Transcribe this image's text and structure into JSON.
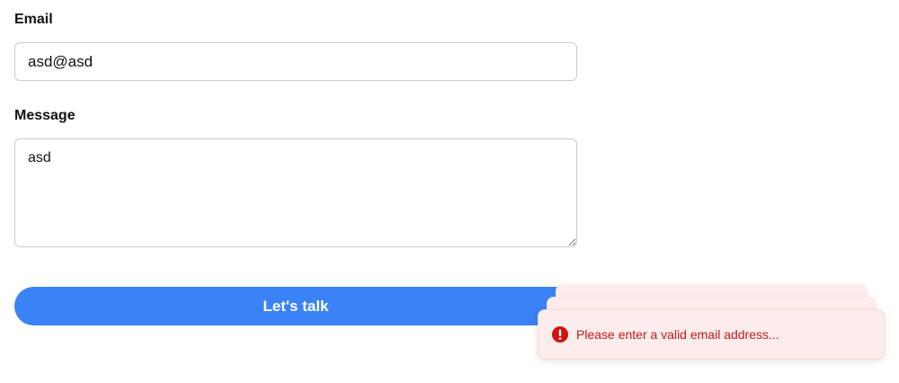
{
  "form": {
    "email": {
      "label": "Email",
      "value": "asd@asd"
    },
    "message": {
      "label": "Message",
      "value": "asd"
    },
    "submit_label": "Let's talk"
  },
  "toast": {
    "icon": "error-icon",
    "message": "Please enter a valid email address...",
    "text_color": "#c11a1a",
    "background_color": "#fdecec"
  },
  "colors": {
    "accent": "#3b82f6"
  }
}
